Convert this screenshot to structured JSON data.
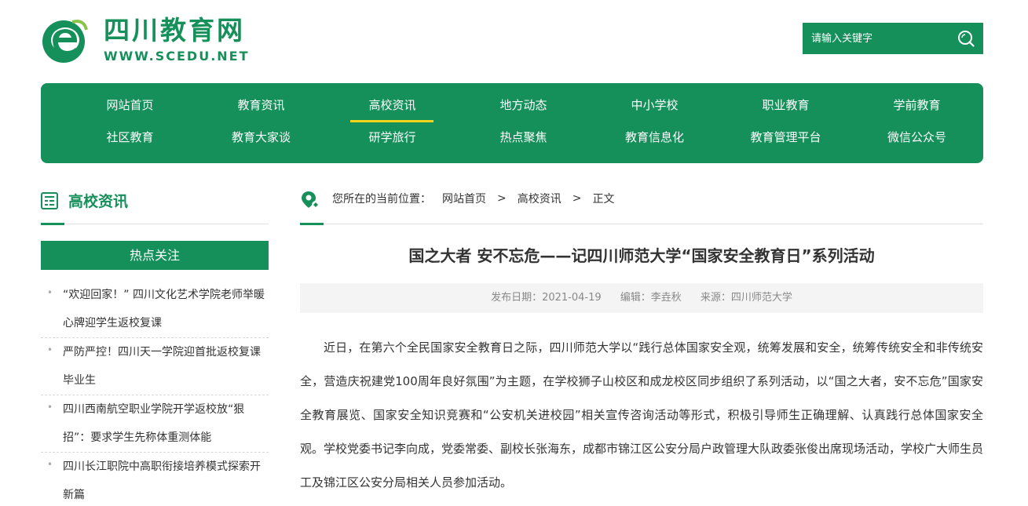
{
  "site": {
    "title": "四川教育网",
    "url": "WWW.SCEDU.NET",
    "brand_color": "#15905a",
    "accent_color": "#f2d21b"
  },
  "search": {
    "placeholder": "请输入关键字",
    "icon": "search-icon"
  },
  "nav": {
    "row1": [
      "网站首页",
      "教育资讯",
      "高校资讯",
      "地方动态",
      "中小学校",
      "职业教育",
      "学前教育"
    ],
    "row2": [
      "社区教育",
      "教育大家谈",
      "研学旅行",
      "热点聚焦",
      "教育信息化",
      "教育管理平台",
      "微信公众号"
    ],
    "active": "高校资讯"
  },
  "sidebar": {
    "title": "高校资讯",
    "hot_title": "热点关注",
    "hot_items": [
      "“欢迎回家！” 四川文化艺术学院老师举暖心牌迎学生返校复课",
      "严防严控！四川天一学院迎首批返校复课毕业生",
      "四川西南航空职业学院开学返校放“狠招”：要求学生先称体重测体能",
      "四川长江职院中高职衔接培养模式探索开新篇"
    ]
  },
  "breadcrumb": {
    "prefix": "您所在的当前位置：",
    "home": "网站首页",
    "section": "高校资讯",
    "current": "正文",
    "sep": ">"
  },
  "article": {
    "title": "国之大者 安不忘危——记四川师范大学“国家安全教育日”系列活动",
    "date": "发布日期：2021-04-19",
    "editor": "编辑：李垚秋",
    "source": "来源：四川师范大学",
    "body": "近日，在第六个全民国家安全教育日之际，四川师范大学以“践行总体国家安全观，统筹发展和安全，统筹传统安全和非传统安全，营造庆祝建党100周年良好氛围”为主题，在学校狮子山校区和成龙校区同步组织了系列活动，以“国之大者，安不忘危”国家安全教育展览、国家安全知识竞赛和“公安机关进校园”相关宣传咨询活动等形式，积极引导师生正确理解、认真践行总体国家安全观。学校党委书记李向成，党委常委、副校长张海东，成都市锦江区公安分局户政管理大队政委张俊出席现场活动，学校广大师生员工及锦江区公安分局相关人员参加活动。"
  }
}
